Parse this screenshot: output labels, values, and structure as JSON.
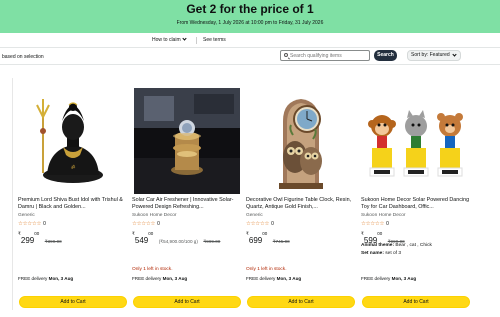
{
  "banner": {
    "title": "Get 2 for the price of 1",
    "subtitle": "From Wednesday, 1 July 2026 at 10:00 pm to Friday, 31 July 2026",
    "background": "#7fe0a4"
  },
  "info": {
    "how_to_claim": "How to claim",
    "see_terms": "See terms"
  },
  "filters": {
    "based_on_selection": "based on selection",
    "search_placeholder": "Search qualifying items",
    "search_button": "Search",
    "sort_label": "Sort by:",
    "sort_value": "Featured"
  },
  "products": [
    {
      "title": "Premium Lord Shiva Bust Idol with Trishul & Damru | Black and Golden...",
      "brand": "Generic",
      "stars": "☆☆☆☆☆",
      "rating_count": "0",
      "currency": "₹",
      "price_whole": "299",
      "price_fraction": "00",
      "unit_price": "",
      "list_price": "₹399.00",
      "stock": "",
      "attr1": "",
      "attr2": "",
      "delivery_prefix": "FREE delivery",
      "delivery_date": "Mon, 3 Aug",
      "cta": "Add to Cart"
    },
    {
      "title": "Solar Car Air Freshener | Innovative Solar-Powered Design Refreshing...",
      "brand": "Sukoon Home Decor",
      "stars": "☆☆☆☆☆",
      "rating_count": "0",
      "currency": "₹",
      "price_whole": "549",
      "price_fraction": "00",
      "unit_price": "(₹54,900.00/100 g)",
      "list_price": "₹999.00",
      "stock": "Only 1 left in stock.",
      "attr1": "",
      "attr2": "",
      "delivery_prefix": "FREE delivery",
      "delivery_date": "Mon, 3 Aug",
      "cta": "Add to Cart"
    },
    {
      "title": "Decorative Owl Figurine Table Clock, Resin, Quartz, Antique Gold Finish,...",
      "brand": "Generic",
      "stars": "☆☆☆☆☆",
      "rating_count": "0",
      "currency": "₹",
      "price_whole": "699",
      "price_fraction": "00",
      "unit_price": "",
      "list_price": "₹745.00",
      "stock": "Only 1 left in stock.",
      "attr1": "",
      "attr2": "",
      "delivery_prefix": "FREE delivery",
      "delivery_date": "Mon, 3 Aug",
      "cta": "Add to Cart"
    },
    {
      "title": "Sukoon Home Decor Solar Powered Dancing Toy for Car Dashboard, Offic...",
      "brand": "Sukoon Home Decor",
      "stars": "☆☆☆☆☆",
      "rating_count": "0",
      "currency": "₹",
      "price_whole": "599",
      "price_fraction": "00",
      "unit_price": "",
      "list_price": "₹999.00",
      "stock": "",
      "attr1_label": "Animal theme:",
      "attr1": "Bear , cat , Chick",
      "attr2_label": "Set name:",
      "attr2": "set of 3",
      "delivery_prefix": "FREE delivery",
      "delivery_date": "Mon, 3 Aug",
      "cta": "Add to Cart"
    }
  ],
  "colors": {
    "cart_button": "#ffd814",
    "stock_warning": "#b12704",
    "star": "#de7921",
    "search_button": "#232f3e"
  }
}
